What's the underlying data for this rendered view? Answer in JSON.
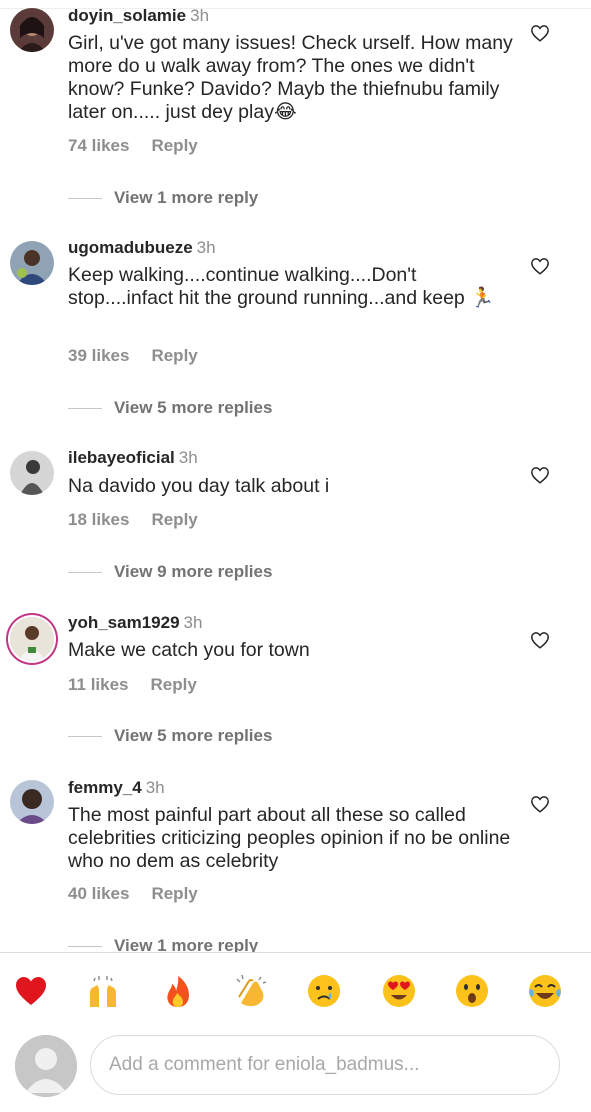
{
  "comments": [
    {
      "username": "doyin_solamie",
      "time": "3h",
      "text": "Girl, u've got many issues! Check urself. How many more do u walk away from? The ones we didn't know? Funke? Davido? Mayb the thiefnubu family later on..... just dey play😂",
      "likes": "74 likes",
      "reply": "Reply",
      "view_replies": "View 1 more reply"
    },
    {
      "username": "ugomadubueze",
      "time": "3h",
      "text": "Keep walking....continue walking....Don't stop....infact hit the ground running...and keep 🏃",
      "likes": "39 likes",
      "reply": "Reply",
      "view_replies": "View 5 more replies"
    },
    {
      "username": "ilebayeoficial",
      "time": "3h",
      "text": "Na davido you day talk about i",
      "likes": "18 likes",
      "reply": "Reply",
      "view_replies": "View 9 more replies"
    },
    {
      "username": "yoh_sam1929",
      "time": "3h",
      "text": "Make we catch you for town",
      "likes": "11 likes",
      "reply": "Reply",
      "view_replies": "View 5 more replies"
    },
    {
      "username": "femmy_4",
      "time": "3h",
      "text": "The most painful part about all these so called celebrities criticizing peoples opinion if no be online who no dem as celebrity",
      "likes": "40 likes",
      "reply": "Reply",
      "view_replies": "View 1 more reply"
    }
  ],
  "emoji_bar": [
    "red-heart",
    "raising-hands",
    "fire",
    "clapping-hands",
    "crying-face",
    "heart-eyes-face",
    "surprised-face",
    "tears-of-joy-face"
  ],
  "compose": {
    "placeholder": "Add a comment for eniola_badmus..."
  },
  "colors": {
    "text": "#262626",
    "secondary": "#8e8e8e",
    "story_ring": "#c13584"
  }
}
